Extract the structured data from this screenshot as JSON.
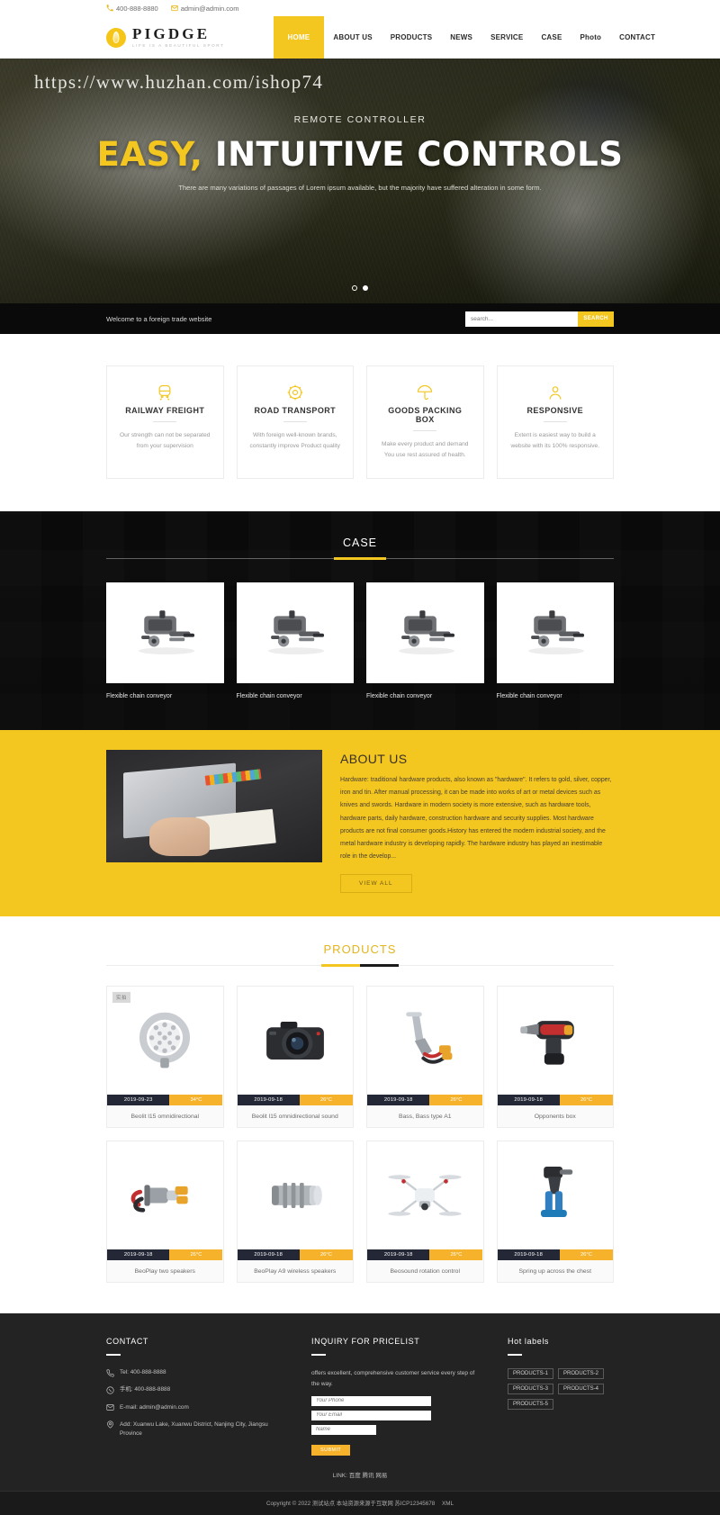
{
  "topbar": {
    "phone": "400-888-8880",
    "email": "admin@admin.com"
  },
  "brand": {
    "name": "PIGDGE",
    "tagline": "LIFE IS A BEAUTIFUL SPORT"
  },
  "nav": [
    {
      "label": "HOME",
      "active": true
    },
    {
      "label": "ABOUT US",
      "active": false
    },
    {
      "label": "PRODUCTS",
      "active": false
    },
    {
      "label": "NEWS",
      "active": false
    },
    {
      "label": "SERVICE",
      "active": false
    },
    {
      "label": "CASE",
      "active": false
    },
    {
      "label": "Photo",
      "active": false
    },
    {
      "label": "CONTACT",
      "active": false
    }
  ],
  "hero": {
    "watermark": "https://www.huzhan.com/ishop74",
    "subtitle": "REMOTE CONTROLLER",
    "title_highlight": "EASY,",
    "title_rest": "INTUITIVE CONTROLS",
    "description": "There are many variations of passages of Lorem ipsum available, but the majority have suffered alteration in some form.",
    "slide_count": 2,
    "active_slide": 2
  },
  "searchbar": {
    "welcome": "Welcome to a foreign trade website",
    "placeholder": "search...",
    "button": "SEARCH"
  },
  "features": [
    {
      "icon": "train-icon",
      "title": "RAILWAY FREIGHT",
      "desc": "Our strength can not be separated from your supervision"
    },
    {
      "icon": "gear-icon",
      "title": "ROAD TRANSPORT",
      "desc": "With foreign well-known brands, constantly improve Product quality"
    },
    {
      "icon": "umbrella-icon",
      "title": "GOODS PACKING BOX",
      "desc": "Make every product and demand You use rest assured of health."
    },
    {
      "icon": "person-icon",
      "title": "RESPONSIVE",
      "desc": "Extent is easiest way to build a website with its 100% responsive."
    }
  ],
  "case": {
    "title": "CASE",
    "items": [
      {
        "caption": "Flexible chain conveyor"
      },
      {
        "caption": "Flexible chain conveyor"
      },
      {
        "caption": "Flexible chain conveyor"
      },
      {
        "caption": "Flexible chain conveyor"
      }
    ]
  },
  "about": {
    "title": "ABOUT US",
    "text": "Hardware: traditional hardware products, also known as \"hardware\". It refers to gold, silver, copper, iron and tin. After manual processing, it can be made into works of art or metal devices such as knives and swords. Hardware in modern society is more extensive, such as hardware tools, hardware parts, daily hardware, construction hardware and security supplies. Most hardware products are not final consumer goods.History has entered the modern industrial society, and the metal hardware industry is developing rapidly. The hardware industry has played an inestimable role in the develop...",
    "button": "VIEW ALL"
  },
  "products": {
    "title": "PRODUCTS",
    "badge": "实拍",
    "items": [
      {
        "name": "Beolit l15 omnidirectional",
        "date": "2019-09-23",
        "temp": "34°C",
        "icon": "ring-light",
        "badge": true
      },
      {
        "name": "Beolit l15 omnidirectional sound",
        "date": "2019-09-18",
        "temp": "26°C",
        "icon": "camera",
        "badge": false
      },
      {
        "name": "Bass, Bass type A1",
        "date": "2019-09-18",
        "temp": "26°C",
        "icon": "cable-tool",
        "badge": false
      },
      {
        "name": "Opponents box",
        "date": "2019-09-18",
        "temp": "26°C",
        "icon": "power-tool",
        "badge": false
      },
      {
        "name": "BeoPlay two speakers",
        "date": "2019-09-18",
        "temp": "26°C",
        "icon": "connector",
        "badge": false
      },
      {
        "name": "BeoPlay A9 wireless speakers",
        "date": "2019-09-18",
        "temp": "26°C",
        "icon": "metal-fitting",
        "badge": false
      },
      {
        "name": "Beosound rotation control",
        "date": "2019-09-18",
        "temp": "26°C",
        "icon": "drone",
        "badge": false
      },
      {
        "name": "Spring up across the chest",
        "date": "2019-09-18",
        "temp": "26°C",
        "icon": "crimping-tool",
        "badge": false
      }
    ]
  },
  "footer": {
    "contact": {
      "title": "CONTACT",
      "rows": [
        {
          "icon": "phone-icon",
          "text": "Tel:  400-888-8888"
        },
        {
          "icon": "mobile-icon",
          "text": "手机:  400-888-8888"
        },
        {
          "icon": "mail-icon",
          "text": "E-mail: admin@admin.com"
        },
        {
          "icon": "location-icon",
          "text": "Add:  Xuanwu Lake, Xuanwu District, Nanjing City, Jiangsu Province"
        }
      ]
    },
    "inquiry": {
      "title": "INQUIRY FOR PRICELIST",
      "text": "offers excellent, comprehensive customer service every step of the way.",
      "phone_placeholder": "Your Phone",
      "email_placeholder": "Your Email",
      "name_placeholder": "Name",
      "submit": "SUBMIT"
    },
    "hot_labels": {
      "title": "Hot labels",
      "items": [
        "PRODUCTS-1",
        "PRODUCTS-2",
        "PRODUCTS-3",
        "PRODUCTS-4",
        "PRODUCTS-5"
      ]
    },
    "link_line": "LINK: 百度 腾讯 网易",
    "copyright": "Copyright © 2022 测试站点 本站资源来源于互联网 苏ICP12345678",
    "xml": "XML"
  },
  "colors": {
    "accent": "#f3c620",
    "amber": "#f5b22a",
    "dark": "#232323",
    "navy": "#242736"
  }
}
